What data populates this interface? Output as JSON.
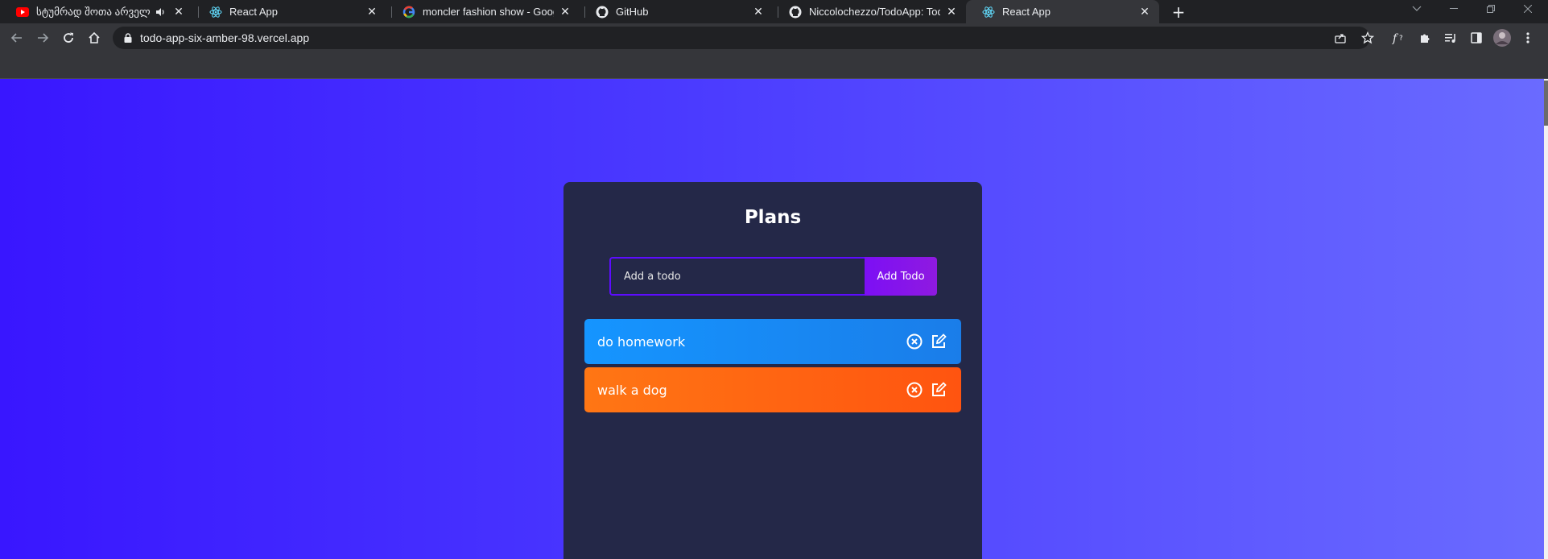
{
  "browser": {
    "tabs": [
      {
        "title": "სტუმრად შოთა არველაძე",
        "favicon": "youtube-icon",
        "audio": true,
        "active": false
      },
      {
        "title": "React App",
        "favicon": "react-icon",
        "active": false
      },
      {
        "title": "moncler fashion show - Google Search",
        "favicon": "google-icon",
        "active": false
      },
      {
        "title": "GitHub",
        "favicon": "github-icon",
        "active": false
      },
      {
        "title": "Niccolochezzo/TodoApp: TodoApp",
        "favicon": "github-icon",
        "active": false
      },
      {
        "title": "React App",
        "favicon": "react-icon",
        "active": true
      }
    ],
    "close_glyph": "✕",
    "new_tab_glyph": "+",
    "url": "todo-app-six-amber-98.vercel.app"
  },
  "app": {
    "title": "Plans",
    "input_placeholder": "Add a todo",
    "add_button_label": "Add Todo",
    "todos": [
      {
        "text": "do homework",
        "color": "#1595ff"
      },
      {
        "text": "walk a dog",
        "color": "#ff7614"
      }
    ]
  },
  "colors": {
    "page_gradient_start": "#3916ff",
    "page_gradient_end": "#6a6bff",
    "card_bg": "#242848",
    "accent": "#5d0cff"
  }
}
